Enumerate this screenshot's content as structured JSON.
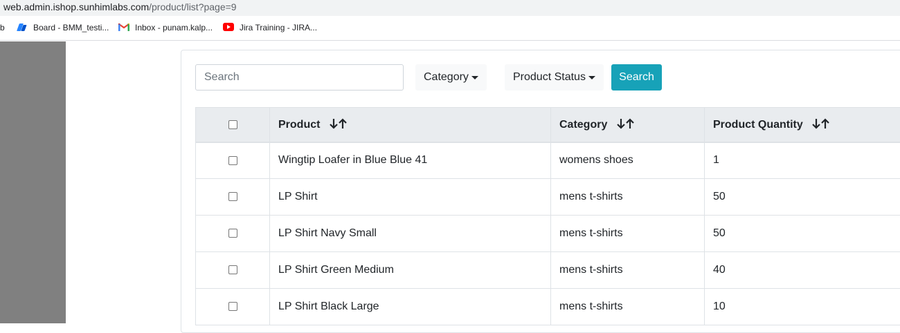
{
  "browser": {
    "url_host": "web.admin.ishop.sunhimlabs.com",
    "url_path": "/product/list?page=9",
    "bookmarks_stub": "b",
    "bookmarks": [
      {
        "label": "Board - BMM_testi...",
        "icon": "jira-board-icon"
      },
      {
        "label": "Inbox - punam.kalp...",
        "icon": "gmail-icon"
      },
      {
        "label": "Jira Training - JIRA...",
        "icon": "youtube-icon"
      }
    ]
  },
  "filters": {
    "search_placeholder": "Search",
    "search_value": "",
    "category_label": "Category",
    "status_label": "Product Status",
    "search_button": "Search"
  },
  "table": {
    "columns": [
      "Product",
      "Category",
      "Product Quantity"
    ],
    "rows": [
      {
        "product": "Wingtip Loafer in Blue Blue 41",
        "category": "womens shoes",
        "quantity": "1"
      },
      {
        "product": "LP Shirt",
        "category": "mens t-shirts",
        "quantity": "50"
      },
      {
        "product": "LP Shirt Navy Small",
        "category": "mens t-shirts",
        "quantity": "50"
      },
      {
        "product": "LP Shirt Green Medium",
        "category": "mens t-shirts",
        "quantity": "40"
      },
      {
        "product": "LP Shirt Black Large",
        "category": "mens t-shirts",
        "quantity": "10"
      }
    ]
  },
  "colors": {
    "accent": "#17a2b8",
    "sidebar": "#808080",
    "table_header": "#e9ecef"
  }
}
